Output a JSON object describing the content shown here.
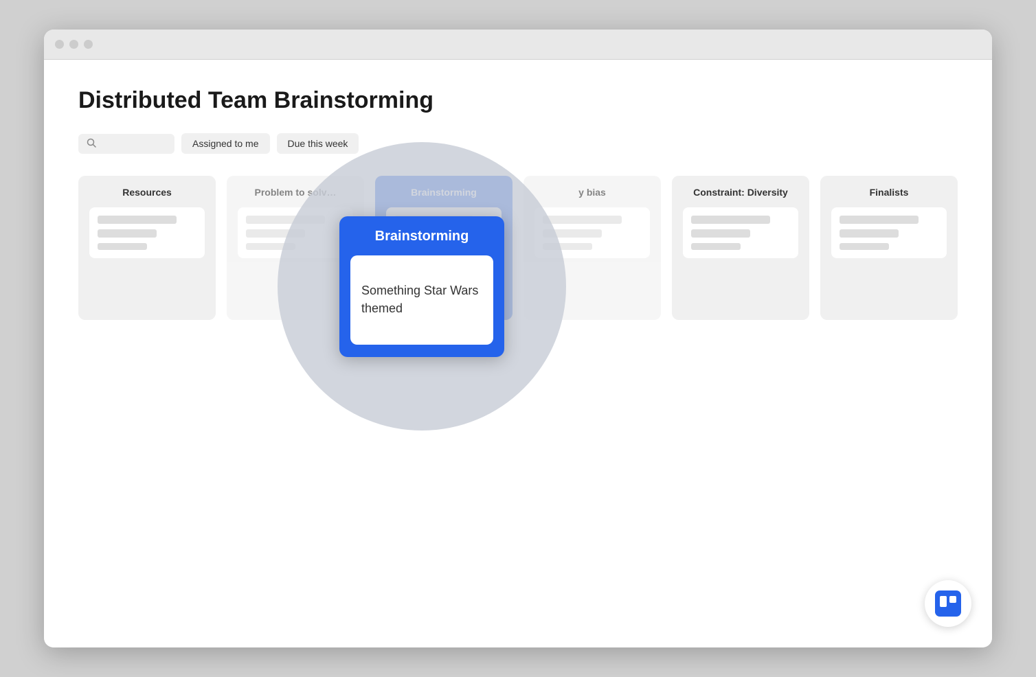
{
  "browser": {
    "title": "Distributed Team Brainstorming"
  },
  "page": {
    "title": "Distributed Team Brainstorming"
  },
  "toolbar": {
    "search_placeholder": "Search",
    "filter1": "Assigned to me",
    "filter2": "Due this week"
  },
  "columns": [
    {
      "id": "resources",
      "label": "Resources",
      "highlighted": false
    },
    {
      "id": "problem-to-solve",
      "label": "Problem to solv…",
      "highlighted": false
    },
    {
      "id": "brainstorming",
      "label": "Brainstorming",
      "highlighted": true
    },
    {
      "id": "y-bias",
      "label": "y bias",
      "highlighted": false
    },
    {
      "id": "constraint-diversity",
      "label": "Constraint: Diversity",
      "highlighted": false
    },
    {
      "id": "finalists",
      "label": "Finalists",
      "highlighted": false
    }
  ],
  "zoomed": {
    "column_label": "Brainstorming",
    "card_text": "Something Star Wars themed"
  },
  "trello": {
    "label": "Trello"
  }
}
